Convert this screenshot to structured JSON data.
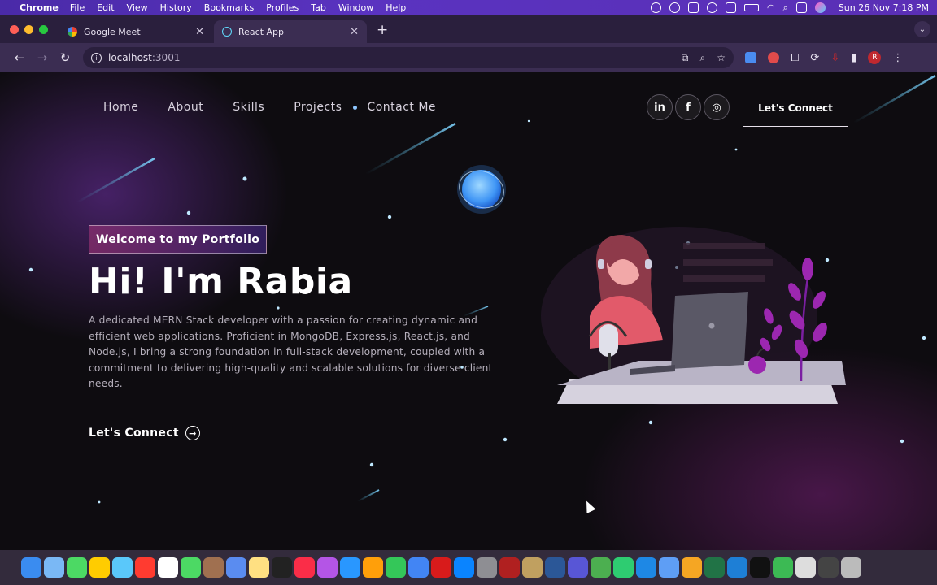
{
  "menubar": {
    "app": "Chrome",
    "items": [
      "File",
      "Edit",
      "View",
      "History",
      "Bookmarks",
      "Profiles",
      "Tab",
      "Window",
      "Help"
    ],
    "clock": "Sun 26 Nov  7:18 PM"
  },
  "browser": {
    "tabs": [
      {
        "title": "Google Meet",
        "active": false,
        "favicon_color": "#34a853"
      },
      {
        "title": "React App",
        "active": true,
        "favicon_color": "#61dafb"
      }
    ],
    "url_host": "localhost",
    "url_port": ":3001",
    "profile_initial": "R"
  },
  "site": {
    "nav": [
      "Home",
      "About",
      "Skills",
      "Projects",
      "Contact Me"
    ],
    "social": [
      {
        "name": "linkedin",
        "glyph": "in"
      },
      {
        "name": "facebook",
        "glyph": "f"
      },
      {
        "name": "instagram",
        "glyph": "◎"
      }
    ],
    "cta_label": "Let's Connect",
    "badge": "Welcome to my Portfolio",
    "title": "Hi! I'm Rabia",
    "description": "A dedicated MERN Stack developer with a passion for creating dynamic and efficient web applications. Proficient in MongoDB, Express.js, React.js, and Node.js, I bring a strong foundation in full-stack development, coupled with a commitment to delivering high-quality and scalable solutions for diverse client needs.",
    "hero_link": "Let's Connect"
  },
  "dock": {
    "icon_colors": [
      "#3a8cf0",
      "#7ab8f5",
      "#4cd964",
      "#ffcc00",
      "#5ac8fa",
      "#ff3b30",
      "#ffffff",
      "#4cd964",
      "#a07050",
      "#5a8cf0",
      "#ffe082",
      "#222222",
      "#fa2d48",
      "#b455e6",
      "#2997ff",
      "#ff9f0a",
      "#34c759",
      "#4285f4",
      "#d81b1b",
      "#0a84ff",
      "#8e8e93",
      "#b02020",
      "#c0a060",
      "#2b5797",
      "#5856d6",
      "#4caf50",
      "#2ecc71",
      "#1e88e5",
      "#5e9ef5",
      "#f5a623",
      "#217346",
      "#1e7fd6",
      "#111111",
      "#3cba54",
      "#dddddd",
      "#444444",
      "#bbbbbb"
    ]
  }
}
